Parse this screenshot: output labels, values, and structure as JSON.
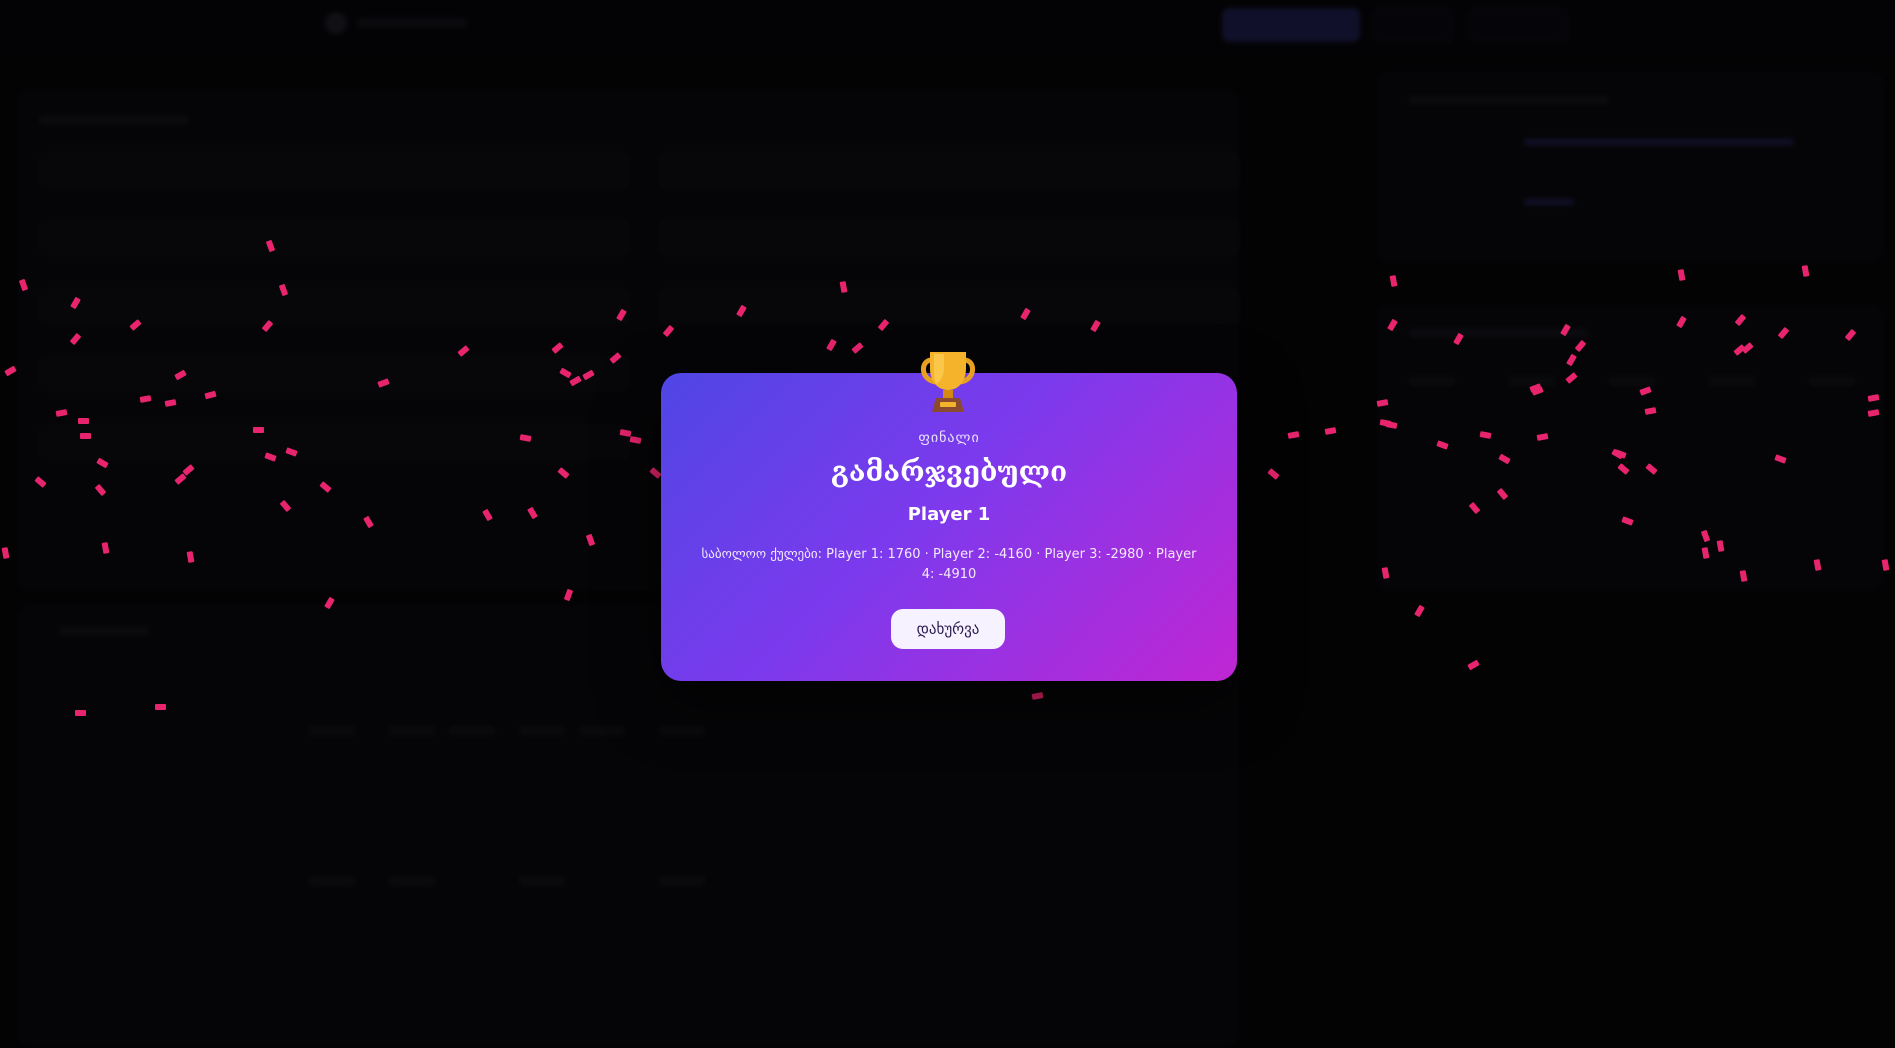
{
  "modal": {
    "kicker": "ფინალი",
    "title": "გამარჯვებული",
    "winner": "Player 1",
    "scores_label": "საბოლოო ქულები:",
    "scores": [
      {
        "player": "Player 1",
        "points": 1760
      },
      {
        "player": "Player 2",
        "points": -4160
      },
      {
        "player": "Player 3",
        "points": -2980
      },
      {
        "player": "Player 4",
        "points": -4910
      }
    ],
    "scores_text": "საბოლოო ქულები: Player 1: 1760 · Player 2: -4160 · Player 3: -2980 · Player 4: -4910",
    "close_label": "დახურვა",
    "icon": "trophy-icon"
  },
  "colors": {
    "gradient_start": "#4f46e5",
    "gradient_mid": "#7c3aed",
    "gradient_end": "#c026d3",
    "confetti": "#e8246e",
    "page_background": "#050507"
  }
}
